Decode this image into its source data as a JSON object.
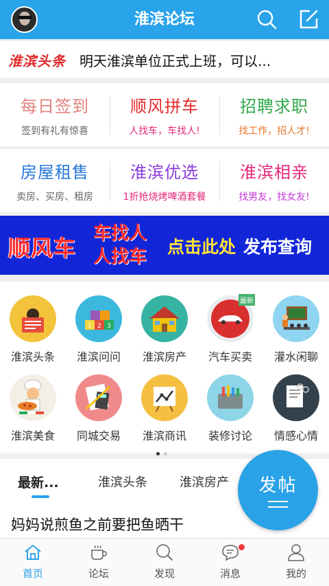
{
  "header": {
    "title": "淮滨论坛",
    "avatar": "user-avatar",
    "icons": [
      "search-icon",
      "edit-icon"
    ]
  },
  "headline": {
    "tag": "淮滨头条",
    "text": "明天淮滨单位正式上班，可以..."
  },
  "features_row1": [
    {
      "title": "每日签到",
      "subtitle": "签到有礼有惊喜",
      "title_color": "#e2837d",
      "subtitle_color": "#666666"
    },
    {
      "title": "顺风拼车",
      "subtitle": "人找车，车找人!",
      "title_color": "#e52a2a",
      "subtitle_color": "#e5287a"
    },
    {
      "title": "招聘求职",
      "subtitle": "找工作，招人才!",
      "title_color": "#31a84a",
      "subtitle_color": "#e5762a"
    }
  ],
  "features_row2": [
    {
      "title": "房屋租售",
      "subtitle": "卖房、买房、租房",
      "title_color": "#2777d8",
      "subtitle_color": "#666666"
    },
    {
      "title": "淮滨优选",
      "subtitle": "1折抢烧烤啤酒套餐",
      "title_color": "#8a3cd8",
      "subtitle_color": "#e5287a"
    },
    {
      "title": "淮滨相亲",
      "subtitle": "找男友，找女友!",
      "title_color": "#e5287a",
      "subtitle_color": "#c43ad8"
    }
  ],
  "banner": {
    "part1": "顺风车",
    "part2_line1": "车找人",
    "part2_line2": "人找车",
    "part3": "点击此处",
    "part4": "发布查询"
  },
  "categories": [
    {
      "label": "淮滨头条",
      "icon": "newspaper-reader-icon",
      "color": "#f3c33c"
    },
    {
      "label": "淮滨问问",
      "icon": "number-blocks-icon",
      "color": "#3cb8de"
    },
    {
      "label": "淮滨房产",
      "icon": "house-icon",
      "color": "#36b3a2"
    },
    {
      "label": "汽车买卖",
      "icon": "car-icon",
      "color": "#e9ecef",
      "badge": "最新"
    },
    {
      "label": "灌水闲聊",
      "icon": "presentation-icon",
      "color": "#8fd4f0"
    },
    {
      "label": "淮滨美食",
      "icon": "chef-icon",
      "color": "#f4efe6"
    },
    {
      "label": "同城交易",
      "icon": "calculator-icon",
      "color": "#f08a8a"
    },
    {
      "label": "淮滨商讯",
      "icon": "chart-board-icon",
      "color": "#f5c042"
    },
    {
      "label": "装修讨论",
      "icon": "tools-bag-icon",
      "color": "#8fd5e8"
    },
    {
      "label": "情感心情",
      "icon": "notes-icon",
      "color": "#33414d"
    }
  ],
  "pager": {
    "current": 1,
    "total": 2
  },
  "tabs": [
    {
      "label": "最新...",
      "active": true
    },
    {
      "label": "淮滨头条",
      "active": false
    },
    {
      "label": "淮滨房产",
      "active": false
    }
  ],
  "post": {
    "title": "妈妈说煎鱼之前要把鱼晒干"
  },
  "fab": {
    "label": "发帖"
  },
  "bottom_nav": [
    {
      "label": "首页",
      "icon": "home-icon",
      "active": true
    },
    {
      "label": "论坛",
      "icon": "coffee-cup-icon",
      "active": false
    },
    {
      "label": "发现",
      "icon": "discover-search-icon",
      "active": false
    },
    {
      "label": "消息",
      "icon": "message-bubble-icon",
      "active": false,
      "notify": true
    },
    {
      "label": "我的",
      "icon": "profile-icon",
      "active": false
    }
  ],
  "colors": {
    "primary": "#29a3ea",
    "banner_bg": "#1226d8",
    "headline_tag": "#e02a2a"
  }
}
